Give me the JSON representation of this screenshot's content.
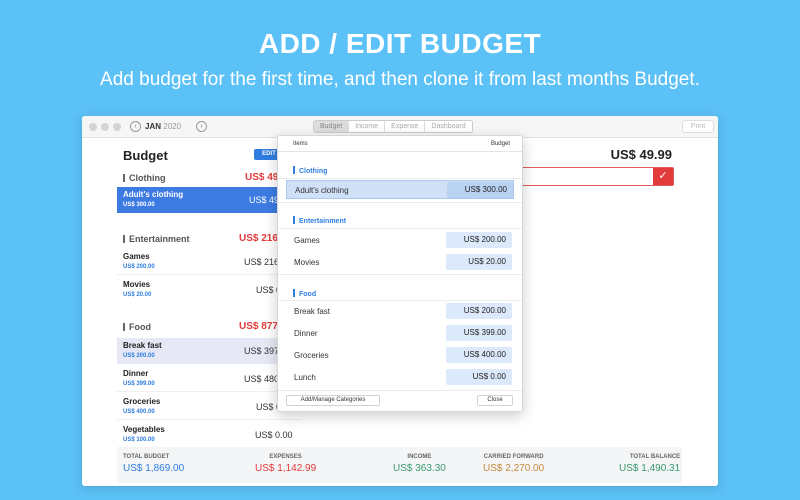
{
  "hero": {
    "title": "ADD / EDIT BUDGET",
    "subtitle": "Add budget for the first time, and then clone it from last months Budget."
  },
  "toolbar": {
    "month": "JAN",
    "year": "2020",
    "tabs": [
      "Budget",
      "Income",
      "Expense",
      "Dashboard"
    ],
    "active_tab": "Budget",
    "print_label": "Print",
    "prev_icon": "chevron-left-icon",
    "next_icon": "chevron-right-icon"
  },
  "budget": {
    "title": "Budget",
    "edit_label": "EDIT",
    "right_total": "US$ 49.99",
    "confirm_icon": "checkmark-icon",
    "categories": [
      {
        "name": "Clothing",
        "amount": "US$ 49.",
        "items": [
          {
            "name": "Adult's clothing",
            "budget": "US$ 300.00",
            "amount": "US$ 49"
          }
        ]
      },
      {
        "name": "Entertainment",
        "amount": "US$ 216.",
        "items": [
          {
            "name": "Games",
            "budget": "US$ 200.00",
            "amount": "US$ 216"
          },
          {
            "name": "Movies",
            "budget": "US$ 20.00",
            "amount": "US$ 0"
          }
        ]
      },
      {
        "name": "Food",
        "amount": "US$ 877.",
        "items": [
          {
            "name": "Break fast",
            "budget": "US$ 200.00",
            "amount": "US$ 397"
          },
          {
            "name": "Dinner",
            "budget": "US$ 399.00",
            "amount": "US$ 480"
          },
          {
            "name": "Groceries",
            "budget": "US$ 400.00",
            "amount": "US$ 0"
          },
          {
            "name": "Vegetables",
            "budget": "US$ 100.00",
            "amount": "US$ 0.00"
          }
        ]
      }
    ]
  },
  "summary": [
    {
      "label": "TOTAL BUDGET",
      "value": "US$ 1,869.00",
      "color": "#2f7de0"
    },
    {
      "label": "EXPENSES",
      "value": "US$ 1,142.99",
      "color": "#e23b3b"
    },
    {
      "label": "INCOME",
      "value": "US$ 363.30",
      "color": "#3a9a6e"
    },
    {
      "label": "CARRIED FORWARD",
      "value": "US$ 2,270.00",
      "color": "#c78a3c"
    },
    {
      "label": "TOTAL BALANCE",
      "value": "US$ 1,490.31",
      "color": "#3a9a6e"
    }
  ],
  "popover": {
    "col_items": "Items",
    "col_budget": "Budget",
    "categories": [
      {
        "name": "Clothing",
        "items": [
          {
            "name": "Adult's clothing",
            "amount": "US$ 300.00"
          }
        ]
      },
      {
        "name": "Entertainment",
        "items": [
          {
            "name": "Games",
            "amount": "US$ 200.00"
          },
          {
            "name": "Movies",
            "amount": "US$ 20.00"
          }
        ]
      },
      {
        "name": "Food",
        "items": [
          {
            "name": "Break fast",
            "amount": "US$ 200.00"
          },
          {
            "name": "Dinner",
            "amount": "US$ 399.00"
          },
          {
            "name": "Groceries",
            "amount": "US$ 400.00"
          },
          {
            "name": "Lunch",
            "amount": "US$ 0.00"
          }
        ]
      }
    ],
    "manage_label": "Add/Manage Categories",
    "close_label": "Close"
  }
}
